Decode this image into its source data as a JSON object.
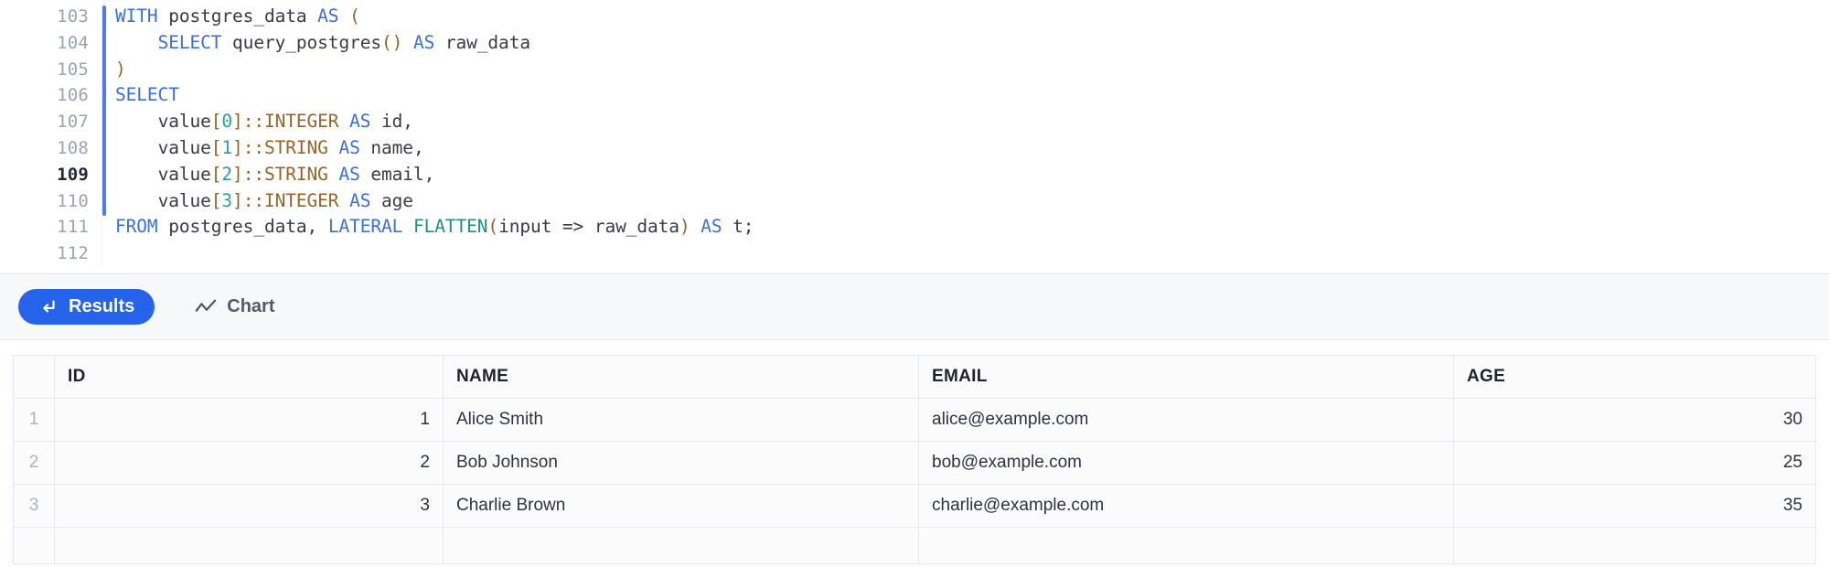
{
  "editor": {
    "line_numbers": [
      "103",
      "104",
      "105",
      "106",
      "107",
      "108",
      "109",
      "110",
      "111",
      "112"
    ],
    "active_line": "109",
    "lines": [
      {
        "n": "103",
        "tokens": [
          {
            "t": "WITH",
            "c": "kw"
          },
          {
            "t": " ",
            "c": "op"
          },
          {
            "t": "postgres_data",
            "c": "ident"
          },
          {
            "t": " ",
            "c": "op"
          },
          {
            "t": "AS",
            "c": "kw"
          },
          {
            "t": " ",
            "c": "op"
          },
          {
            "t": "(",
            "c": "punc"
          }
        ]
      },
      {
        "n": "104",
        "tokens": [
          {
            "t": "    ",
            "c": "op"
          },
          {
            "t": "SELECT",
            "c": "kw"
          },
          {
            "t": " ",
            "c": "op"
          },
          {
            "t": "query_postgres",
            "c": "ident"
          },
          {
            "t": "()",
            "c": "punc"
          },
          {
            "t": " ",
            "c": "op"
          },
          {
            "t": "AS",
            "c": "kw"
          },
          {
            "t": " ",
            "c": "op"
          },
          {
            "t": "raw_data",
            "c": "ident"
          }
        ]
      },
      {
        "n": "105",
        "tokens": [
          {
            "t": ")",
            "c": "punc"
          }
        ]
      },
      {
        "n": "106",
        "tokens": [
          {
            "t": "SELECT",
            "c": "kw"
          }
        ]
      },
      {
        "n": "107",
        "tokens": [
          {
            "t": "    ",
            "c": "op"
          },
          {
            "t": "value",
            "c": "ident"
          },
          {
            "t": "[",
            "c": "punc"
          },
          {
            "t": "0",
            "c": "num"
          },
          {
            "t": "]",
            "c": "punc"
          },
          {
            "t": "::INTEGER",
            "c": "type"
          },
          {
            "t": " ",
            "c": "op"
          },
          {
            "t": "AS",
            "c": "kw"
          },
          {
            "t": " ",
            "c": "op"
          },
          {
            "t": "id",
            "c": "ident"
          },
          {
            "t": ",",
            "c": "op"
          }
        ]
      },
      {
        "n": "108",
        "tokens": [
          {
            "t": "    ",
            "c": "op"
          },
          {
            "t": "value",
            "c": "ident"
          },
          {
            "t": "[",
            "c": "punc"
          },
          {
            "t": "1",
            "c": "num"
          },
          {
            "t": "]",
            "c": "punc"
          },
          {
            "t": "::STRING",
            "c": "type"
          },
          {
            "t": " ",
            "c": "op"
          },
          {
            "t": "AS",
            "c": "kw"
          },
          {
            "t": " ",
            "c": "op"
          },
          {
            "t": "name",
            "c": "ident"
          },
          {
            "t": ",",
            "c": "op"
          }
        ]
      },
      {
        "n": "109",
        "tokens": [
          {
            "t": "    ",
            "c": "op"
          },
          {
            "t": "value",
            "c": "ident"
          },
          {
            "t": "[",
            "c": "punc"
          },
          {
            "t": "2",
            "c": "num"
          },
          {
            "t": "]",
            "c": "punc"
          },
          {
            "t": "::STRING",
            "c": "type"
          },
          {
            "t": " ",
            "c": "op"
          },
          {
            "t": "AS",
            "c": "kw"
          },
          {
            "t": " ",
            "c": "op"
          },
          {
            "t": "email",
            "c": "ident"
          },
          {
            "t": ",",
            "c": "op"
          }
        ]
      },
      {
        "n": "110",
        "tokens": [
          {
            "t": "    ",
            "c": "op"
          },
          {
            "t": "value",
            "c": "ident"
          },
          {
            "t": "[",
            "c": "punc"
          },
          {
            "t": "3",
            "c": "num"
          },
          {
            "t": "]",
            "c": "punc"
          },
          {
            "t": "::INTEGER",
            "c": "type"
          },
          {
            "t": " ",
            "c": "op"
          },
          {
            "t": "AS",
            "c": "kw"
          },
          {
            "t": " ",
            "c": "op"
          },
          {
            "t": "age",
            "c": "ident"
          }
        ]
      },
      {
        "n": "111",
        "tokens": [
          {
            "t": "FROM",
            "c": "kw"
          },
          {
            "t": " ",
            "c": "op"
          },
          {
            "t": "postgres_data",
            "c": "ident"
          },
          {
            "t": ", ",
            "c": "op"
          },
          {
            "t": "LATERAL",
            "c": "kw"
          },
          {
            "t": " ",
            "c": "op"
          },
          {
            "t": "FLATTEN",
            "c": "fn"
          },
          {
            "t": "(",
            "c": "punc"
          },
          {
            "t": "input",
            "c": "ident"
          },
          {
            "t": " => ",
            "c": "op"
          },
          {
            "t": "raw_data",
            "c": "ident"
          },
          {
            "t": ")",
            "c": "punc"
          },
          {
            "t": " ",
            "c": "op"
          },
          {
            "t": "AS",
            "c": "kw"
          },
          {
            "t": " ",
            "c": "op"
          },
          {
            "t": "t",
            "c": "ident"
          },
          {
            "t": ";",
            "c": "op"
          }
        ]
      },
      {
        "n": "112",
        "tokens": []
      }
    ],
    "plain_text": "WITH postgres_data AS (\n    SELECT query_postgres() AS raw_data\n)\nSELECT\n    value[0]::INTEGER AS id,\n    value[1]::STRING AS name,\n    value[2]::STRING AS email,\n    value[3]::INTEGER AS age\nFROM postgres_data, LATERAL FLATTEN(input => raw_data) AS t;\n"
  },
  "tabs": {
    "items": [
      {
        "label": "Results",
        "icon": "arrow-return-icon",
        "active": true
      },
      {
        "label": "Chart",
        "icon": "line-chart-icon",
        "active": false
      }
    ],
    "active_color": "#2563eb"
  },
  "results_table": {
    "columns": [
      "",
      "ID",
      "NAME",
      "EMAIL",
      "AGE"
    ],
    "rows": [
      {
        "rownum": "1",
        "id": "1",
        "name": "Alice Smith",
        "email": "alice@example.com",
        "age": "30"
      },
      {
        "rownum": "2",
        "id": "2",
        "name": "Bob Johnson",
        "email": "bob@example.com",
        "age": "25"
      },
      {
        "rownum": "3",
        "id": "3",
        "name": "Charlie Brown",
        "email": "charlie@example.com",
        "age": "35"
      }
    ],
    "empty_row": {
      "rownum": "",
      "id": "",
      "name": "",
      "email": "",
      "age": ""
    }
  }
}
